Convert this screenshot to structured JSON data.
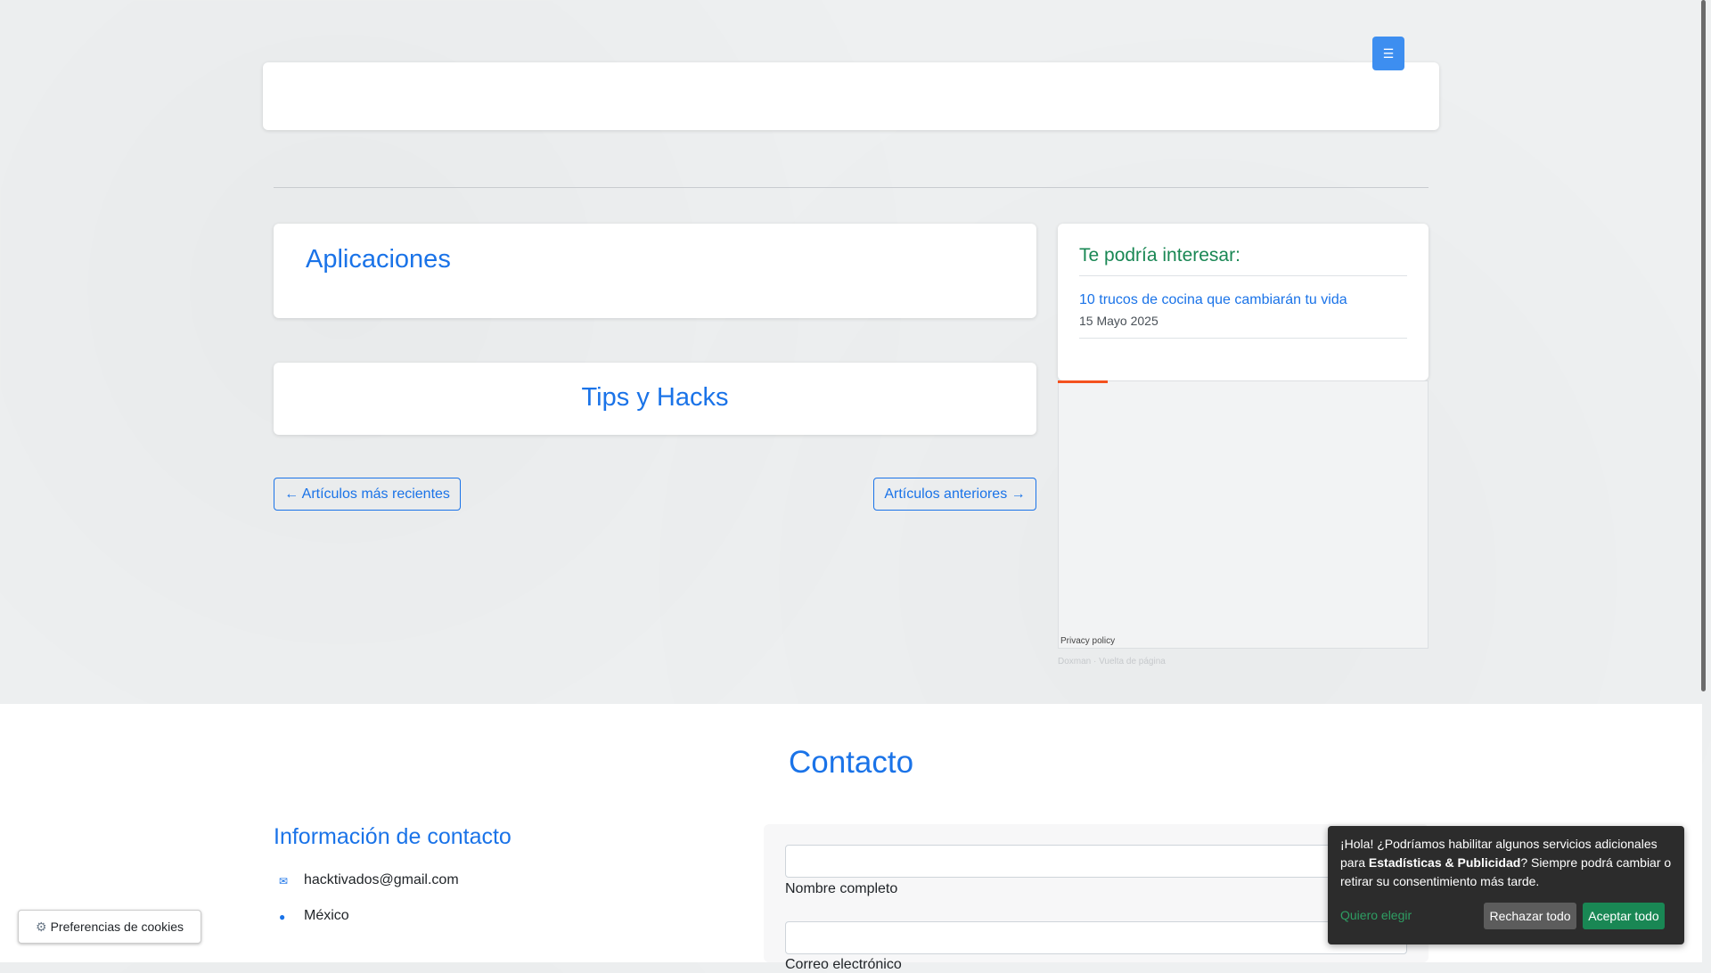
{
  "header": {
    "menu_icon": "bars-icon"
  },
  "category": {
    "title": "Aplicaciones"
  },
  "section": {
    "title": "Tips y Hacks"
  },
  "pager": {
    "newer": "← Artículos más recientes",
    "older": "Artículos anteriores →"
  },
  "sidebar": {
    "title": "Te podría interesar:",
    "items": [
      {
        "title": "10 trucos de cocina que cambiarán tu vida",
        "date": "15 Mayo 2025"
      }
    ],
    "ad_privacy": "Privacy policy",
    "ad_links": "Doxman · Vuelta de página"
  },
  "contact": {
    "title": "Contacto",
    "info_title": "Información de contacto",
    "email": "hacktivados@gmail.com",
    "country": "México",
    "email_icon": "envelope-icon",
    "country_icon": "map-marker-icon"
  },
  "form": {
    "name_label": "Nombre completo",
    "email_label": "Correo electrónico"
  },
  "cookie": {
    "text_before": "¡Hola! ¿Podríamos habilitar algunos servicios adicionales para ",
    "text_bold": "Estadísticas & Publicidad",
    "text_after": "? Siempre podrá cambiar o retirar su consentimiento más tarde.",
    "choose": "Quiero elegir",
    "reject": "Rechazar todo",
    "accept": "Aceptar todo",
    "prefs_button": "Preferencias de cookies"
  },
  "colors": {
    "link": "#1a73e8",
    "accent_green": "#198754",
    "ad_accent": "#f4511e"
  }
}
